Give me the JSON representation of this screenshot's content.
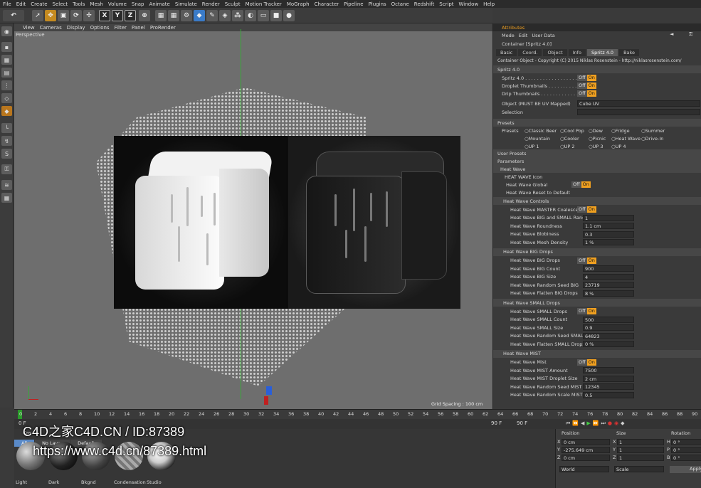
{
  "menu": [
    "File",
    "Edit",
    "Create",
    "Select",
    "Tools",
    "Mesh",
    "Volume",
    "Snap",
    "Animate",
    "Simulate",
    "Render",
    "Sculpt",
    "Motion Tracker",
    "MoGraph",
    "Character",
    "Pipeline",
    "Plugins",
    "Octane",
    "Redshift",
    "Script",
    "Window",
    "Help"
  ],
  "toolbar": {
    "x": "X",
    "y": "Y",
    "z": "Z",
    "undo": "↶"
  },
  "viewport": {
    "menu": [
      "View",
      "Cameras",
      "Display",
      "Options",
      "Filter",
      "Panel",
      "ProRender"
    ],
    "label": "Perspective",
    "grid_spacing": "Grid Spacing : 100 cm"
  },
  "attributes": {
    "title": "Attributes",
    "menu": [
      "Mode",
      "Edit",
      "User Data"
    ],
    "object_name": "Container [Spritz 4.0]",
    "tabs": [
      "Basic",
      "Coord.",
      "Object",
      "Info",
      "Spritz 4.0",
      "Bake"
    ],
    "active_tab": "Spritz 4.0",
    "copyright": "Container Object - Copyright (C) 2015 Niklas Rosenstein - http://niklasrosenstein.com/",
    "section": "Spritz 4.0",
    "rows1": [
      {
        "label": "Spritz 4.0 . . . . . . . . . . . . . . . . . ."
      },
      {
        "label": "Droplet Thumbnails . . . . . . . . . . . ."
      },
      {
        "label": "Drip Thumbnails . . . . . . . . . . . . . ."
      }
    ],
    "off": "Off",
    "on": "On",
    "object_label": "Object (MUST BE UV Mapped)",
    "object_value": "Cube UV",
    "selection_label": "Selection",
    "presets_header": "Presets",
    "presets_label": "Presets",
    "presets_row1": [
      "Classic Beer",
      "Cool Pop",
      "Dew",
      "Fridge",
      "Summer"
    ],
    "presets_row2": [
      "Mountain",
      "Cooler",
      "Picnic",
      "Heat Wave",
      "Drive-In"
    ],
    "presets_row3": [
      "UP 1",
      "UP 2",
      "UP 3",
      "UP 4"
    ],
    "user_presets": "User Presets",
    "parameters": "Parameters",
    "heat_wave": "Heat Wave",
    "heat_wave_icon": "HEAT WAVE Icon",
    "heat_wave_global": "Heat Wave Global",
    "heat_wave_reset": "Heat Wave Reset to Default",
    "controls_header": "Heat Wave Controls",
    "controls": [
      {
        "label": "Heat Wave MASTER Coalesce",
        "value": ""
      },
      {
        "label": "Heat Wave BIG and SMALL Random Scale",
        "value": "1"
      },
      {
        "label": "Heat Wave Roundness",
        "value": "1.1 cm"
      },
      {
        "label": "Heat Wave Blobiness",
        "value": "0.3"
      },
      {
        "label": "Heat Wave Mesh Density",
        "value": "1 %"
      }
    ],
    "big_header": "Heat Wave BIG Drops",
    "big": [
      {
        "label": "Heat Wave BIG Drops",
        "value": ""
      },
      {
        "label": "Heat Wave BIG Count",
        "value": "900"
      },
      {
        "label": "Heat Wave BIG Size",
        "value": "4"
      },
      {
        "label": "Heat Wave Random Seed BIG",
        "value": "23719"
      },
      {
        "label": "Heat Wave Flatten BIG Drops",
        "value": "8 %"
      }
    ],
    "small_header": "Heat Wave SMALL Drops",
    "small": [
      {
        "label": "Heat Wave SMALL Drops",
        "value": ""
      },
      {
        "label": "Heat Wave SMALL Count",
        "value": "500"
      },
      {
        "label": "Heat Wave SMALL Size",
        "value": "0.9"
      },
      {
        "label": "Heat Wave Random Seed SMALL",
        "value": "64823"
      },
      {
        "label": "Heat Wave Flatten SMALL Drops",
        "value": "0 %"
      }
    ],
    "mist_header": "Heat Wave MIST",
    "mist": [
      {
        "label": "Heat Wave Mist",
        "value": ""
      },
      {
        "label": "Heat Wave MIST Amount",
        "value": "7500"
      },
      {
        "label": "Heat Wave MIST Droplet Size",
        "value": "2 cm"
      },
      {
        "label": "Heat Wave Random Seed MIST",
        "value": "12345"
      },
      {
        "label": "Heat Wave Random Scale MIST",
        "value": "0.5"
      }
    ]
  },
  "timeline": {
    "ticks": [
      "0",
      "2",
      "4",
      "6",
      "8",
      "10",
      "12",
      "14",
      "16",
      "18",
      "20",
      "22",
      "24",
      "26",
      "28",
      "30",
      "32",
      "34",
      "36",
      "38",
      "40",
      "42",
      "44",
      "46",
      "48",
      "50",
      "52",
      "54",
      "56",
      "58",
      "60",
      "62",
      "64",
      "66",
      "68",
      "70",
      "72",
      "74",
      "76",
      "78",
      "80",
      "82",
      "84",
      "86",
      "88",
      "90"
    ],
    "start": "0 F",
    "end1": "90 F",
    "end2": "90 F",
    "current": "0 F"
  },
  "materials": {
    "menu_prefix": "Cre",
    "filters": [
      "All",
      "No Layer",
      "Default"
    ],
    "items": [
      "Light",
      "Dark",
      "Bkgnd",
      "Condensation",
      "Studio"
    ]
  },
  "coords": {
    "headers": [
      "Position",
      "Size",
      "Rotation"
    ],
    "rows": [
      {
        "axis": "X",
        "pos": "0 cm",
        "size_axis": "X",
        "size": "1",
        "rot_axis": "H",
        "rot": "0 °"
      },
      {
        "axis": "Y",
        "pos": "-275.649 cm",
        "size_axis": "Y",
        "size": "1",
        "rot_axis": "P",
        "rot": "0 °"
      },
      {
        "axis": "Z",
        "pos": "0 cm",
        "size_axis": "Z",
        "size": "1",
        "rot_axis": "B",
        "rot": "0 °"
      }
    ],
    "mode1": "World",
    "mode2": "Scale",
    "apply": "Apply"
  },
  "watermark": {
    "line1": "C4D之家C4D.CN / ID:87389",
    "line2": "https://www.c4d.cn/87389.html"
  }
}
